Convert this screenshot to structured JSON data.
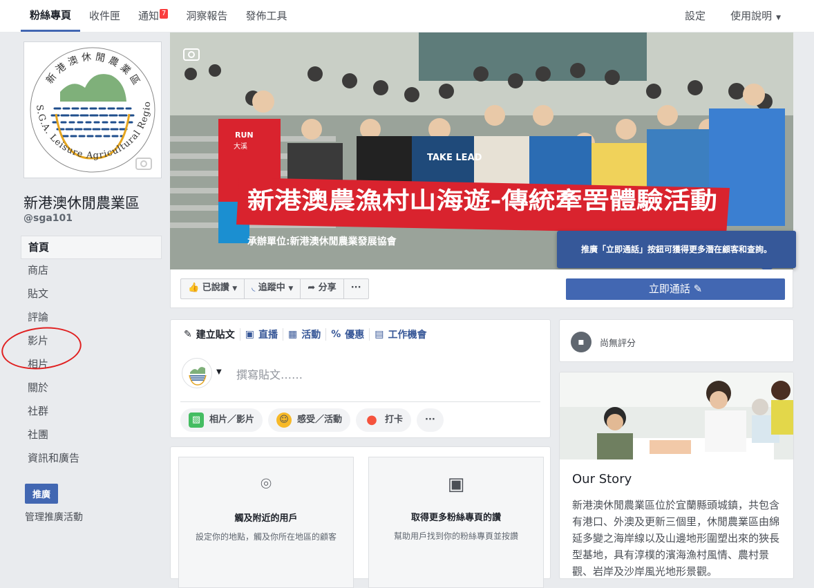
{
  "topnav": {
    "tabs": [
      {
        "label": "粉絲專頁",
        "active": true
      },
      {
        "label": "收件匣"
      },
      {
        "label": "通知",
        "badge": "7"
      },
      {
        "label": "洞察報告"
      },
      {
        "label": "發佈工具"
      }
    ],
    "right": [
      {
        "label": "設定"
      },
      {
        "label": "使用說明"
      }
    ]
  },
  "page": {
    "name": "新港澳休閒農業區",
    "handle": "@sga101",
    "logo_text_top": "新港澳休閒農業區",
    "logo_text_bottom": "S.G.A. Leisure Agricultural Region"
  },
  "sidebar": {
    "items": [
      {
        "label": "首頁",
        "active": true
      },
      {
        "label": "商店"
      },
      {
        "label": "貼文"
      },
      {
        "label": "評論"
      },
      {
        "label": "影片",
        "highlighted": true
      },
      {
        "label": "相片"
      },
      {
        "label": "關於"
      },
      {
        "label": "社群"
      },
      {
        "label": "社團"
      },
      {
        "label": "資訊和廣告"
      }
    ],
    "promote_label": "推廣",
    "manage_label": "管理推廣活動"
  },
  "cover": {
    "banner_main": "新港澳農漁村山海遊-傳統牽罟體驗活動",
    "banner_sub": "承辦單位:新港澳休閒農業發展協會",
    "shirt_text": "大溪",
    "shirt_text2": "RUN",
    "tee_text": "TAKE LEAD"
  },
  "actions": {
    "liked": "已說讚",
    "following": "追蹤中",
    "share": "分享",
    "more": "···",
    "call_now": "立即通話"
  },
  "tooltip": "推廣「立即通話」按鈕可獲得更多潛在顧客和查詢。",
  "composer": {
    "tabs": [
      "建立貼文",
      "直播",
      "活動",
      "優惠",
      "工作機會"
    ],
    "placeholder": "撰寫貼文……",
    "pills": [
      "相片／影片",
      "感受／活動",
      "打卡",
      "···"
    ]
  },
  "promo_cards": [
    {
      "title": "觸及附近的用戶",
      "desc": "設定你的地點，觸及你所在地區的顧客"
    },
    {
      "title": "取得更多粉絲專頁的讚",
      "desc": "幫助用戶找到你的粉絲專頁並按讚"
    }
  ],
  "reviews": {
    "text": "尚無評分"
  },
  "story": {
    "title": "Our Story",
    "body": "新港澳休閒農業區位於宜蘭縣頭城鎮，共包含有港口、外澳及更新三個里，休閒農業區由綿延多變之海岸線以及山邊地形圍塑出來的狹長型基地，具有淳樸的濱海漁村風情、農村景觀、岩岸及沙岸風光地形景觀。"
  },
  "colors": {
    "accent": "#4267b2",
    "banner": "#d9232e",
    "notification": "#fa3e3e"
  }
}
